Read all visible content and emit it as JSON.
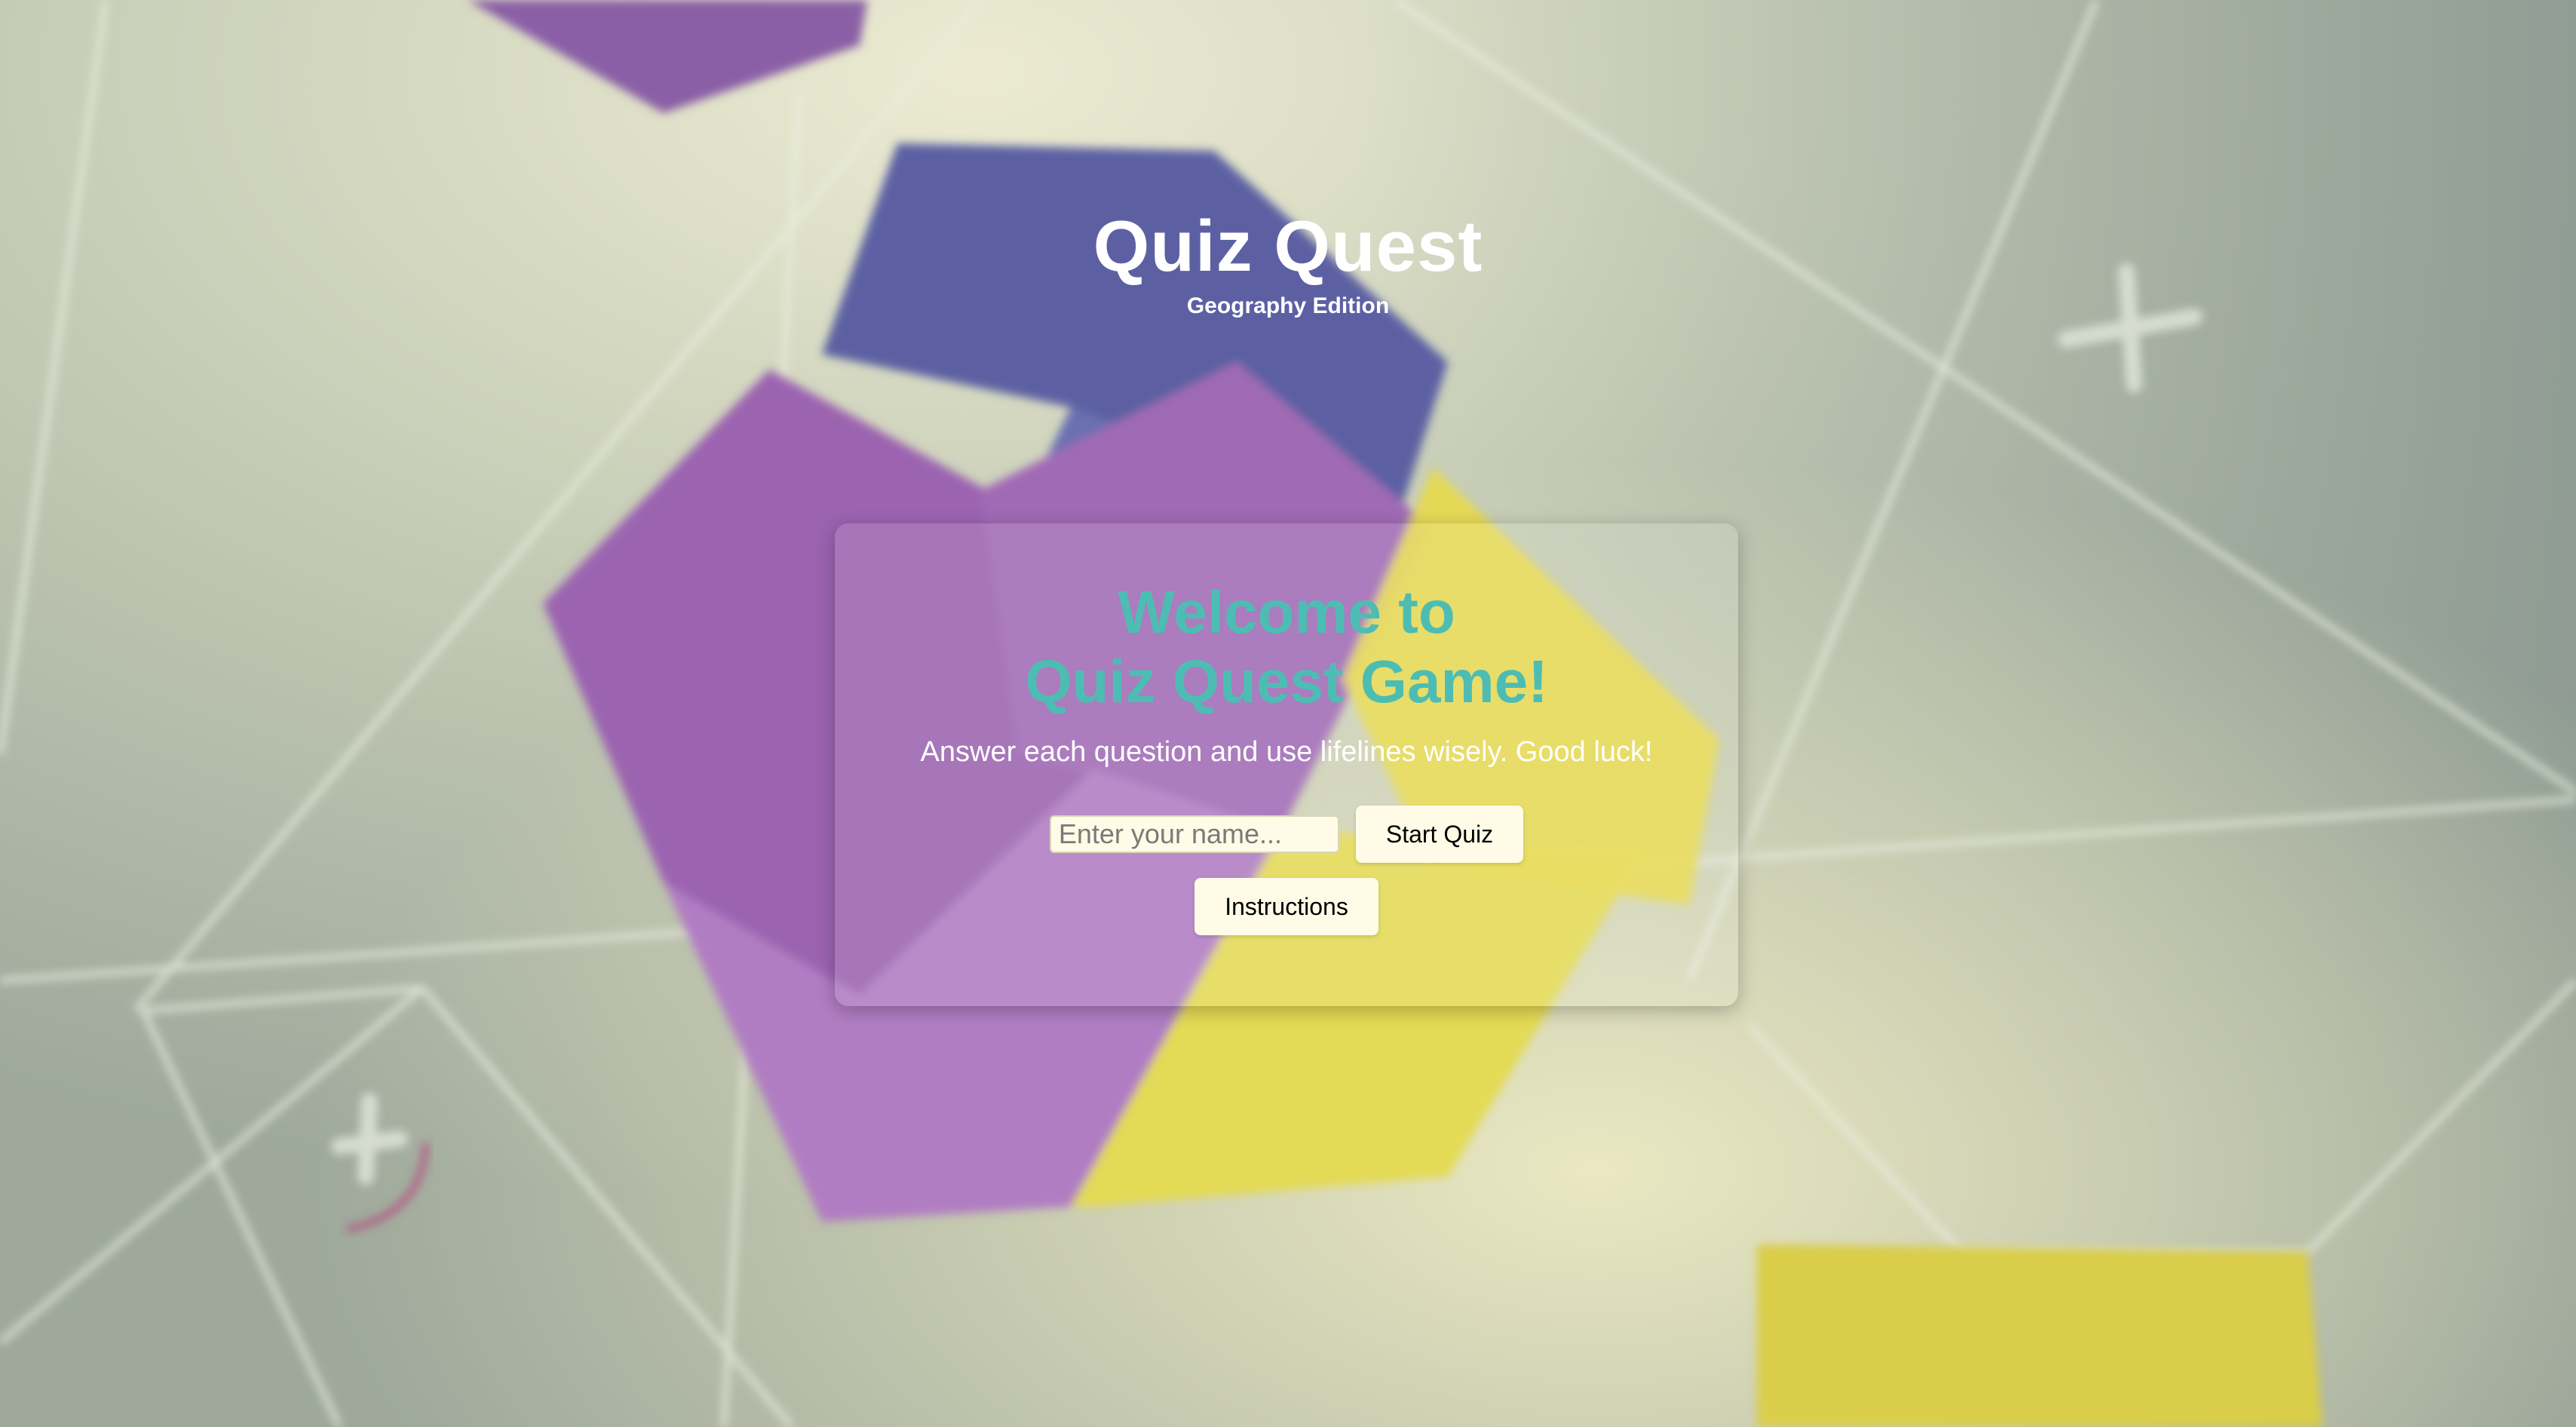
{
  "header": {
    "title": "Quiz Quest",
    "subtitle": "Geography Edition"
  },
  "card": {
    "welcome_line1": "Welcome to",
    "welcome_line2": "Quiz Quest Game!",
    "tagline": "Answer each question and use lifelines wisely. Good luck!",
    "name_placeholder": "Enter your name...",
    "start_label": "Start Quiz",
    "instructions_label": "Instructions"
  },
  "colors": {
    "accent": "#4dbdb3",
    "button_bg": "#fffbe6",
    "purple": "#9a63b3",
    "indigo": "#5a5fa0",
    "yellow": "#e6d94f"
  },
  "background": {
    "shapes": [
      "purple-cube",
      "indigo-cube",
      "yellow-block",
      "plus-sign-icon"
    ]
  }
}
